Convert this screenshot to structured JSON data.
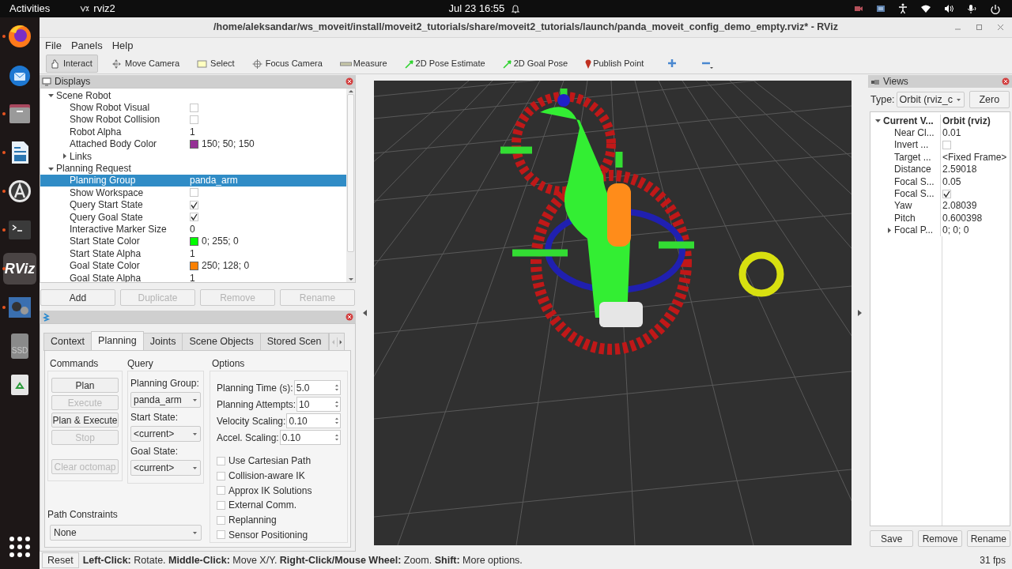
{
  "top_bar": {
    "activities": "Activities",
    "app": "rviz2",
    "clock": "Jul 23  16:55"
  },
  "dock": [
    {
      "kind": "browser",
      "running": true
    },
    {
      "kind": "mail",
      "running": false
    },
    {
      "kind": "files",
      "running": true
    },
    {
      "kind": "document",
      "running": true
    },
    {
      "kind": "software",
      "running": true
    },
    {
      "kind": "terminal",
      "running": true
    },
    {
      "kind": "rviz",
      "label": "RViz",
      "running": true
    },
    {
      "kind": "video",
      "running": true
    },
    {
      "kind": "drive",
      "label": "SSD",
      "running": false
    },
    {
      "kind": "trash",
      "running": false
    },
    {
      "kind": "apps"
    }
  ],
  "window": {
    "title": "/home/aleksandar/ws_moveit/install/moveit2_tutorials/share/moveit2_tutorials/launch/panda_moveit_config_demo_empty.rviz* - RViz"
  },
  "menu": [
    "File",
    "Panels",
    "Help"
  ],
  "toolbar": [
    {
      "kind": "interact",
      "label": "Interact",
      "selected": true
    },
    {
      "kind": "camera",
      "label": "Move Camera",
      "selected": false
    },
    {
      "kind": "select",
      "label": "Select",
      "selected": false
    },
    {
      "kind": "focus",
      "label": "Focus Camera",
      "selected": false
    },
    {
      "kind": "measure",
      "label": "Measure",
      "selected": false
    },
    {
      "kind": "pose",
      "label": "2D Pose Estimate",
      "selected": false
    },
    {
      "kind": "pose",
      "label": "2D Goal Pose",
      "selected": false
    },
    {
      "kind": "point",
      "label": "Publish Point",
      "selected": false
    },
    {
      "kind": "add",
      "selected": false
    },
    {
      "kind": "remove",
      "selected": false
    }
  ],
  "displays": {
    "title": "Displays",
    "tree": [
      {
        "label": "Scene Robot",
        "expanded": true,
        "selected": false,
        "children": [
          {
            "label": "Show Robot Visual",
            "kind": "checkbox",
            "checked": false,
            "selected": false
          },
          {
            "label": "Show Robot Collision",
            "kind": "checkbox",
            "checked": false,
            "selected": false
          },
          {
            "label": "Robot Alpha",
            "kind": "text",
            "value": "1",
            "selected": false
          },
          {
            "label": "Attached Body Color",
            "kind": "color",
            "value": "150; 50; 150",
            "color": "#963296",
            "selected": false
          },
          {
            "label": "Links",
            "expanded": false,
            "selected": false
          }
        ]
      },
      {
        "label": "Planning Request",
        "expanded": true,
        "selected": false,
        "children": [
          {
            "label": "Planning Group",
            "kind": "text",
            "value": "panda_arm",
            "selected": true
          },
          {
            "label": "Show Workspace",
            "kind": "checkbox",
            "checked": false,
            "selected": false
          },
          {
            "label": "Query Start State",
            "kind": "checkbox",
            "checked": true,
            "selected": false
          },
          {
            "label": "Query Goal State",
            "kind": "checkbox",
            "checked": true,
            "selected": false
          },
          {
            "label": "Interactive Marker Size",
            "kind": "text",
            "value": "0",
            "selected": false
          },
          {
            "label": "Start State Color",
            "kind": "color",
            "value": "0; 255; 0",
            "color": "#00ff00",
            "selected": false
          },
          {
            "label": "Start State Alpha",
            "kind": "text",
            "value": "1",
            "selected": false
          },
          {
            "label": "Goal State Color",
            "kind": "color",
            "value": "250; 128; 0",
            "color": "#fa8000",
            "selected": false
          },
          {
            "label": "Goal State Alpha",
            "kind": "text",
            "value": "1",
            "selected": false
          }
        ]
      }
    ],
    "buttons": [
      {
        "label": "Add",
        "disabled": false
      },
      {
        "label": "Duplicate",
        "disabled": true
      },
      {
        "label": "Remove",
        "disabled": true
      },
      {
        "label": "Rename",
        "disabled": true
      }
    ]
  },
  "motion_planning": {
    "tabs": [
      {
        "label": "Context",
        "selected": false
      },
      {
        "label": "Planning",
        "selected": true
      },
      {
        "label": "Joints",
        "selected": false
      },
      {
        "label": "Scene Objects",
        "selected": false
      },
      {
        "label": "Stored Scen",
        "selected": false
      }
    ],
    "commands": {
      "title": "Commands",
      "buttons": [
        {
          "label": "Plan",
          "disabled": false
        },
        {
          "label": "Execute",
          "disabled": true
        },
        {
          "label": "Plan & Execute",
          "disabled": false
        },
        {
          "label": "Stop",
          "disabled": true
        },
        {
          "label": "Clear octomap",
          "disabled": true
        }
      ]
    },
    "query": {
      "title": "Query",
      "fields": [
        {
          "label": "Planning Group:",
          "value": "panda_arm"
        },
        {
          "label": "Start State:",
          "value": "<current>"
        },
        {
          "label": "Goal State:",
          "value": "<current>"
        }
      ]
    },
    "options": {
      "title": "Options",
      "spinboxes": [
        {
          "label": "Planning Time (s):",
          "value": "5.0"
        },
        {
          "label": "Planning Attempts:",
          "value": "10"
        },
        {
          "label": "Velocity Scaling:",
          "value": "0.10"
        },
        {
          "label": "Accel. Scaling:",
          "value": "0.10"
        }
      ],
      "checkboxes": [
        {
          "label": "Use Cartesian Path",
          "checked": false
        },
        {
          "label": "Collision-aware IK",
          "checked": false
        },
        {
          "label": "Approx IK Solutions",
          "checked": false
        },
        {
          "label": "External Comm.",
          "checked": false
        },
        {
          "label": "Replanning",
          "checked": false
        },
        {
          "label": "Sensor Positioning",
          "checked": false
        }
      ]
    },
    "path_constraints": {
      "label": "Path Constraints",
      "value": "None"
    }
  },
  "views": {
    "title": "Views",
    "type_label": "Type:",
    "type_value": "Orbit (rviz_c",
    "zero": "Zero",
    "tree": [
      {
        "label": "Current V...",
        "value": "Orbit (rviz)",
        "expanded": true,
        "children": [
          {
            "label": "Near Cl...",
            "kind": "text",
            "value": "0.01"
          },
          {
            "label": "Invert ...",
            "kind": "checkbox",
            "checked": false
          },
          {
            "label": "Target ...",
            "kind": "text",
            "value": "<Fixed Frame>"
          },
          {
            "label": "Distance",
            "kind": "text",
            "value": "2.59018"
          },
          {
            "label": "Focal S...",
            "kind": "text",
            "value": "0.05"
          },
          {
            "label": "Focal S...",
            "kind": "checkbox",
            "checked": true
          },
          {
            "label": "Yaw",
            "kind": "text",
            "value": "2.08039"
          },
          {
            "label": "Pitch",
            "kind": "text",
            "value": "0.600398"
          },
          {
            "label": "Focal P...",
            "kind": "text",
            "value": "0; 0; 0",
            "expanded": false
          }
        ]
      }
    ],
    "buttons": [
      "Save",
      "Remove",
      "Rename"
    ]
  },
  "status_bar": {
    "reset": "Reset",
    "help": "**Left-Click:** Rotate. **Middle-Click:** Move X/Y. **Right-Click/Mouse Wheel:** Zoom. **Shift:** More options.",
    "fps": "31 fps"
  }
}
